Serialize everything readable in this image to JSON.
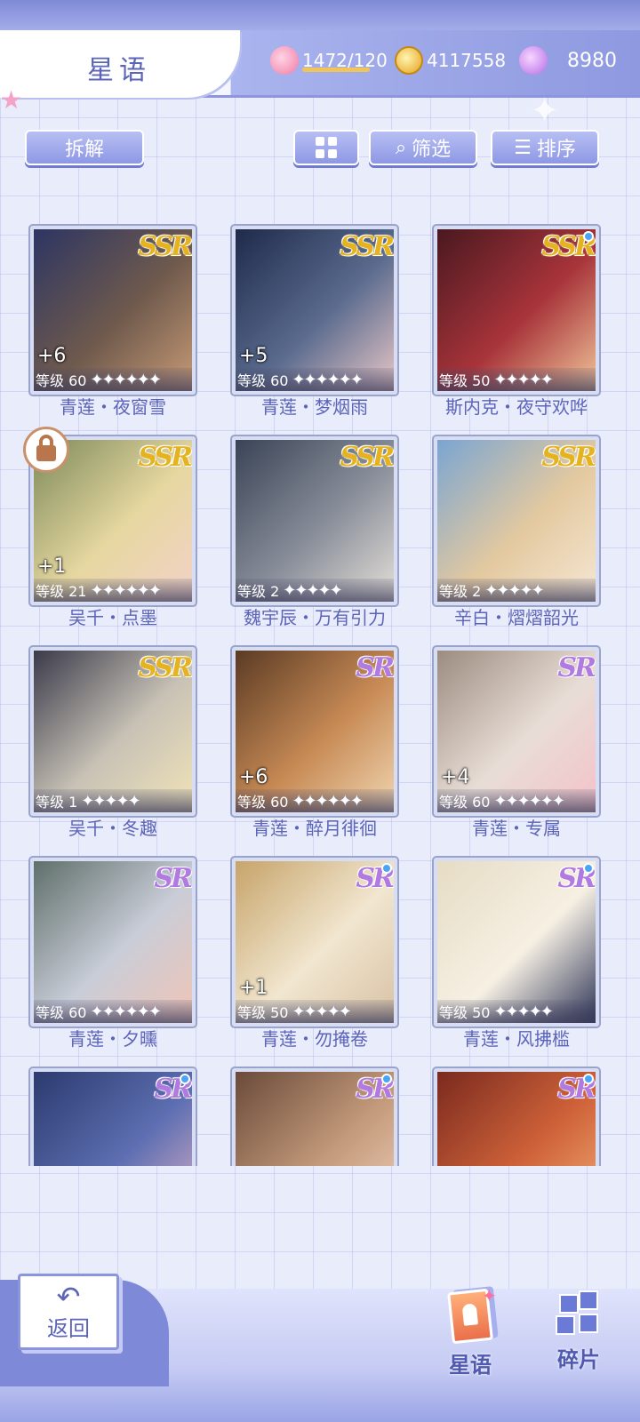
{
  "header": {
    "title": "星语",
    "stamina": "1472/120",
    "coins": "4117558",
    "gems": "8980"
  },
  "toolbar": {
    "dismantle_label": "拆解",
    "filter_label": "筛选",
    "sort_label": "排序"
  },
  "cards": [
    {
      "name": "青莲・夜窗雪",
      "rarity": "SSR",
      "level": "等级 60",
      "plus": "+6",
      "stars": "✦✦✦✦✦✦",
      "new": false,
      "locked": false,
      "colors": [
        "#2d3563",
        "#6f5a4d",
        "#c79a76"
      ]
    },
    {
      "name": "青莲・梦烟雨",
      "rarity": "SSR",
      "level": "等级 60",
      "plus": "+5",
      "stars": "✦✦✦✦✦✦",
      "new": false,
      "locked": false,
      "colors": [
        "#1f2a4a",
        "#5a6b8e",
        "#e8c7c7"
      ]
    },
    {
      "name": "斯内克・夜守欢哗",
      "rarity": "SSR",
      "level": "等级 50",
      "plus": "",
      "stars": "✦✦✦✦✦",
      "new": true,
      "locked": false,
      "colors": [
        "#4a1820",
        "#a8343a",
        "#f0c59a"
      ]
    },
    {
      "name": "吴千・点墨",
      "rarity": "SSR",
      "level": "等级 21",
      "plus": "+1",
      "stars": "✦✦✦✦✦✦",
      "new": false,
      "locked": true,
      "colors": [
        "#7c8a5a",
        "#e6d7a0",
        "#f3d2c8"
      ]
    },
    {
      "name": "魏宇辰・万有引力",
      "rarity": "SSR",
      "level": "等级 2",
      "plus": "",
      "stars": "✦✦✦✦✦",
      "new": false,
      "locked": false,
      "colors": [
        "#3a4456",
        "#8a8f9b",
        "#e5e0d8"
      ]
    },
    {
      "name": "辛白・熠熠韶光",
      "rarity": "SSR",
      "level": "等级 2",
      "plus": "",
      "stars": "✦✦✦✦✦",
      "new": false,
      "locked": false,
      "colors": [
        "#7aa5d2",
        "#e3c9a0",
        "#f5e7d3"
      ]
    },
    {
      "name": "吴千・冬趣",
      "rarity": "SSR",
      "level": "等级 1",
      "plus": "",
      "stars": "✦✦✦✦✦",
      "new": false,
      "locked": false,
      "colors": [
        "#3a3a4a",
        "#c8c2b6",
        "#f1e3b8"
      ]
    },
    {
      "name": "青莲・醉月徘徊",
      "rarity": "SR",
      "level": "等级 60",
      "plus": "+6",
      "stars": "✦✦✦✦✦✦",
      "new": false,
      "locked": false,
      "colors": [
        "#5b3b24",
        "#c78a55",
        "#f0d5b0"
      ]
    },
    {
      "name": "青莲・专属",
      "rarity": "SR",
      "level": "等级 60",
      "plus": "+4",
      "stars": "✦✦✦✦✦✦",
      "new": false,
      "locked": false,
      "colors": [
        "#9c8c80",
        "#e8ddd6",
        "#f3c2c8"
      ]
    },
    {
      "name": "青莲・夕曛",
      "rarity": "SR",
      "level": "等级 60",
      "plus": "",
      "stars": "✦✦✦✦✦✦",
      "new": false,
      "locked": false,
      "colors": [
        "#5f6f6a",
        "#c9cdd8",
        "#f0c4b6"
      ]
    },
    {
      "name": "青莲・勿掩卷",
      "rarity": "SR",
      "level": "等级 50",
      "plus": "+1",
      "stars": "✦✦✦✦✦",
      "new": true,
      "locked": false,
      "colors": [
        "#c7a46a",
        "#f1e6cf",
        "#d8c1a4"
      ]
    },
    {
      "name": "青莲・风拂槛",
      "rarity": "SR",
      "level": "等级 50",
      "plus": "",
      "stars": "✦✦✦✦✦",
      "new": true,
      "locked": false,
      "colors": [
        "#e6dcc5",
        "#f6f0e3",
        "#2e3557"
      ]
    },
    {
      "name": "",
      "rarity": "SR",
      "level": "",
      "plus": "",
      "stars": "",
      "new": true,
      "locked": false,
      "colors": [
        "#2c3a6e",
        "#5d6fb2",
        "#e3b4c6"
      ]
    },
    {
      "name": "",
      "rarity": "SR",
      "level": "",
      "plus": "",
      "stars": "",
      "new": true,
      "locked": false,
      "colors": [
        "#6a4a3a",
        "#c39a7a",
        "#f3d2c0"
      ]
    },
    {
      "name": "",
      "rarity": "SR",
      "level": "",
      "plus": "",
      "stars": "",
      "new": true,
      "locked": false,
      "colors": [
        "#7a2a1e",
        "#d0633a",
        "#f2b07a"
      ]
    }
  ],
  "bottom_nav": {
    "back_label": "返回",
    "stars_label": "星语",
    "fragments_label": "碎片"
  }
}
